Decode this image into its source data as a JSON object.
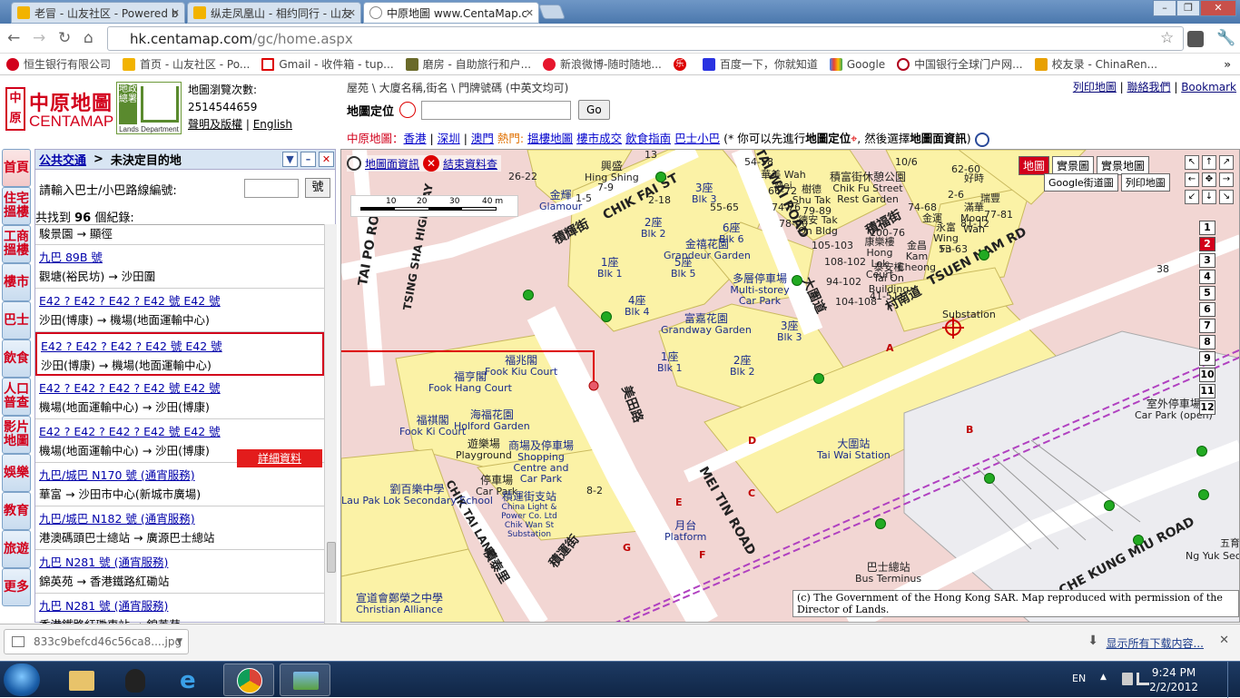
{
  "browser": {
    "tabs": [
      {
        "title": "老冒 - 山友社区 - Powered b"
      },
      {
        "title": "纵走凤凰山 - 相约同行 - 山友"
      },
      {
        "title": "中原地圖 www.CentaMap.c"
      }
    ],
    "url_host": "hk.centamap.com",
    "url_path": "/gc/home.aspx",
    "bookmarks": [
      "恒生银行有限公司",
      "首页 - 山友社区 - Po...",
      "Gmail - 收件箱 - tup...",
      "磨房 - 自助旅行和户...",
      "新浪微博-随时随地...",
      "乐",
      "百度一下，你就知道",
      "Google",
      "中国银行全球门户网...",
      "校友录 - ChinaRen..."
    ],
    "more": "»"
  },
  "header": {
    "logo_zh": "中原地圖",
    "logo_en": "CENTAMAP",
    "logo_mark": "中原",
    "lands_zh": "地政總署",
    "lands_en": "Lands Department",
    "visits_label": "地圖瀏覽次數:",
    "visits_count": "2514544659",
    "disclaimer": "聲明及版權",
    "english": "English",
    "search_hint": "屋苑 \\ 大廈名稱,街名 \\ 門牌號碼 (中英文均可)",
    "locate_label": "地圖定位",
    "go": "Go",
    "toplinks": [
      "列印地圖",
      "聯絡我們",
      "Bookmark"
    ],
    "linkbar_prefix": "中原地圖：",
    "linkbar_places": [
      "香港",
      "深圳",
      "澳門"
    ],
    "linkbar_hot": "熱門:",
    "linkbar_links": [
      "搵樓地圖",
      "樓市成交",
      "飲食指南",
      "巴士小巴"
    ],
    "linkbar_note_a": "(* 你可以先進行",
    "linkbar_note_b": "地圖定位",
    "linkbar_note_c": ", 然後選擇",
    "linkbar_note_d": "地圖面資訊",
    "linkbar_note_e": ")"
  },
  "sidenav": [
    "首頁",
    "住宅搵樓",
    "工商搵樓",
    "樓市",
    "巴士",
    "飲食",
    "人口普查",
    "影片地圖",
    "娛樂",
    "教育",
    "旅遊",
    "更多"
  ],
  "panel": {
    "crumb_link": "公共交通",
    "crumb_sep": ">",
    "crumb_current": "未決定目的地",
    "bus_prompt": "請輸入巴士/小巴路線編號:",
    "bus_button": "號",
    "found_prefix": "共找到 ",
    "found_count": "96",
    "found_suffix": " 個紀錄:",
    "detail": "詳細資料",
    "results": [
      {
        "route": "",
        "desc": "駿景園 → 顯徑"
      },
      {
        "route": "九巴 89B 號",
        "desc": "觀塘(裕民坊) → 沙田圍"
      },
      {
        "route": "E42 ? E42 ? E42 ? E42 號 E42 號",
        "desc": "沙田(博康) → 機場(地面運輸中心)"
      },
      {
        "route": "E42 ? E42 ? E42 ? E42 號 E42 號",
        "desc": "沙田(博康) → 機場(地面運輸中心)"
      },
      {
        "route": "E42 ? E42 ? E42 ? E42 號 E42 號",
        "desc": "機場(地面運輸中心) → 沙田(博康)"
      },
      {
        "route": "E42 ? E42 ? E42 ? E42 號 E42 號",
        "desc": "機場(地面運輸中心) → 沙田(博康)"
      },
      {
        "route": "九巴/城巴 N170 號 (通宵服務)",
        "desc": "華富 → 沙田市中心(新城市廣場)"
      },
      {
        "route": "九巴/城巴 N182 號 (通宵服務)",
        "desc": "港澳碼頭巴士總站 → 廣源巴士總站"
      },
      {
        "route": "九巴 N281 號 (通宵服務)",
        "desc": "錦英苑 → 香港鐵路紅磡站"
      },
      {
        "route": "九巴 N281 號 (通宵服務)",
        "desc": "香港鐵路紅磡車站 → 錦英苑"
      }
    ]
  },
  "map": {
    "tool_info": "地圖面資訊",
    "tool_end": "結束資料查",
    "scale_ticks": [
      "10",
      "20",
      "30",
      "40 m"
    ],
    "tabs": [
      "地圖",
      "實景圖",
      "實景地圖"
    ],
    "tabs2": [
      "Google街道圖",
      "列印地圖"
    ],
    "zoom_levels": [
      "1",
      "2",
      "3",
      "4",
      "5",
      "6",
      "7",
      "8",
      "9",
      "10",
      "11",
      "12"
    ],
    "zoom_selected": "2",
    "copyright": "(c) The Government of the Hong Kong SAR. Map reproduced with permission of the Director of Lands.",
    "labels": {
      "fook_chak": "福澤閣",
      "hing_shing_zh": "興盛",
      "hing_shing_en": "Hing Shing",
      "kam_fai": "金輝",
      "glamour": "Glamour",
      "chik_fai_st": "CHIK FAI ST",
      "chik_fai_zh": "積輝街",
      "tai_wai_road": "TAI WAI ROAD",
      "grandeur_zh": "金禧花園",
      "grandeur_en": "Grandeur Garden",
      "blk2": "2座",
      "blk2_en": "Blk 2",
      "blk3": "3座",
      "blk3_en": "Blk 3",
      "blk6": "6座",
      "blk6_en": "Blk 6",
      "blk5": "5座",
      "blk5_en": "Blk 5",
      "blk1": "1座",
      "blk1_en": "Blk 1",
      "blk4": "4座",
      "blk4_en": "Blk 4",
      "carpark_zh": "多層停車場",
      "carpark_en": "Multi-storey Car Park",
      "granday_zh": "富嘉花園",
      "granday_en": "Grandway Garden",
      "fook_hang_zh": "福亨閣",
      "fook_hang_en": "Fook Hang Court",
      "fook_kiu_zh": "福兆閣",
      "fook_kiu_en": "Fook Kiu Court",
      "fook_ki_zh": "福祺閣",
      "fook_ki_en": "Fook Ki Court",
      "holford_zh": "海福花園",
      "holford_en": "Holford Garden",
      "playground_zh": "遊樂場",
      "playground_en": "Playground",
      "shopping_zh": "商場及停車場",
      "shopping_en": "Shopping Centre and Car Park",
      "carpark2_zh": "停車場",
      "carpark2_en": "Car Park",
      "mei_tin_road_zh": "美田路",
      "mei_tin_road": "MEI TIN ROAD",
      "tai_wai_station_zh": "大圍站",
      "tai_wai_station_en": "Tai Wai Station",
      "platform_zh": "月台",
      "platform_en": "Platform",
      "bus_terminus_zh": "巴士總站",
      "bus_terminus_en": "Bus Terminus",
      "chik_wan_zh": "積運街支站",
      "chik_wan_en": "China Light & Power Co. Ltd Chik Wan St Substation",
      "chik_tai_lane": "CHIK TAI LANE",
      "chik_tai_zh": "積泰里",
      "chik_wan_st_zh": "積運街",
      "lau_pak_lok_zh": "劉百樂中學",
      "lau_pak_lok_en": "Lau Pak Lok Secondary School",
      "christian_zh": "宣道會鄭榮之中學",
      "christian_en": "Christian Alliance",
      "tai_po_road": "TAI PO ROAD",
      "tsing_sha": "TSING SHA HIGHWAY",
      "chik_fu_zh": "積富街休憩公園",
      "chik_fu_en": "Chik Fu Street Rest Garden",
      "tsuen_nam_rd": "TSUEN NAM RD",
      "tsuen_nam_zh": "村南道",
      "tai_wai_dao": "大圍道",
      "chik_ming_zh": "積福街",
      "hong_lok": "康樂樓 Hong Lok Court",
      "tai_on": "泰安樓 Tai On Building",
      "substation": "Substation",
      "carpark_open_zh": "室外停車場",
      "carpark_open_en": "Car Park (open)",
      "che_kung_miu": "CHE KUNG MIU ROAD",
      "ng_yuk": "Ng Yuk Second",
      "wu_fu": "五育",
      "wah_mei": "華美 Wah Mei",
      "shu_tak": "樹德 Shu Tak",
      "tak_on": "德安 Tak On Bldg",
      "moon_wah": "滿華 Moon Wah",
      "kam_cheong": "金昌 Kam Cheong",
      "wing_fu": "永富 Wing Fu",
      "kam_wan": "金運",
      "hou_yan": "好時",
      "kau_fu": "瑞豐",
      "ltrA": "A",
      "ltrB": "B",
      "ltrC": "C",
      "ltrD": "D",
      "ltrE": "E",
      "ltrF": "F",
      "ltrG": "G",
      "n2226": "26-22",
      "n15": "1-5",
      "n13": "13",
      "n79": "7-9",
      "n218": "2-18",
      "n5465": "54-58",
      "n6672": "66-72",
      "n7476": "74-76",
      "n7989": "79-89",
      "n7890": "78-90",
      "n105103": "105-103",
      "n108102": "108-102",
      "n94102": "94-102",
      "n104108": "104-108",
      "n4151": "41-51",
      "n100": "100-76",
      "n6260": "62-60",
      "n26": "2-6",
      "n7468": "74-68",
      "n5363": "53-63",
      "n8182": "81-12",
      "n7781": "77-81",
      "n38": "38",
      "n82": "8-2",
      "n5565": "55-65",
      "n106": "10/6"
    }
  },
  "download": {
    "file": "833c9befcd46c56ca8....jpg",
    "show_all": "显示所有下载内容...",
    "close": "✕"
  },
  "taskbar": {
    "lang": "EN",
    "time": "9:24 PM",
    "date": "2/2/2012"
  },
  "colors": {
    "brand_red": "#d2001b",
    "link_blue": "#0000aa",
    "map_bg": "#f2d6d3"
  }
}
